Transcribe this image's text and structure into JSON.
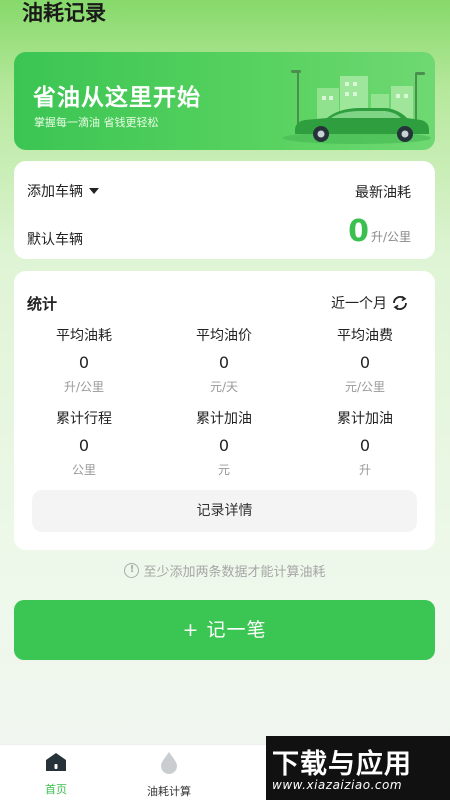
{
  "header": {
    "title": "油耗记录"
  },
  "banner": {
    "title": "省油从这里开始",
    "subtitle": "掌握每一滴油  省钱更轻松"
  },
  "vehicle": {
    "add_label": "添加车辆",
    "latest_label": "最新油耗",
    "default_label": "默认车辆",
    "consumption_value": "0",
    "consumption_unit": "升/公里"
  },
  "stats": {
    "title": "统计",
    "period": "近一个月",
    "items": [
      {
        "label": "平均油耗",
        "value": "0",
        "unit": "升/公里"
      },
      {
        "label": "平均油价",
        "value": "0",
        "unit": "元/天"
      },
      {
        "label": "平均油费",
        "value": "0",
        "unit": "元/公里"
      },
      {
        "label": "累计行程",
        "value": "0",
        "unit": "公里"
      },
      {
        "label": "累计加油",
        "value": "0",
        "unit": "元"
      },
      {
        "label": "累计加油",
        "value": "0",
        "unit": "升"
      }
    ],
    "detail_button": "记录详情"
  },
  "hint": "至少添加两条数据才能计算油耗",
  "record_button": "+ 记一笔",
  "tabbar": {
    "home": "首页",
    "calc": "油耗计算"
  },
  "watermark": {
    "title": "下载与应用",
    "url": "www.xiazaiziao.com"
  },
  "colors": {
    "accent": "#3bc553",
    "value_green": "#3ac04e"
  },
  "icons": [
    "caret-down-icon",
    "refresh-icon",
    "info-icon",
    "home-icon",
    "droplet-icon"
  ]
}
